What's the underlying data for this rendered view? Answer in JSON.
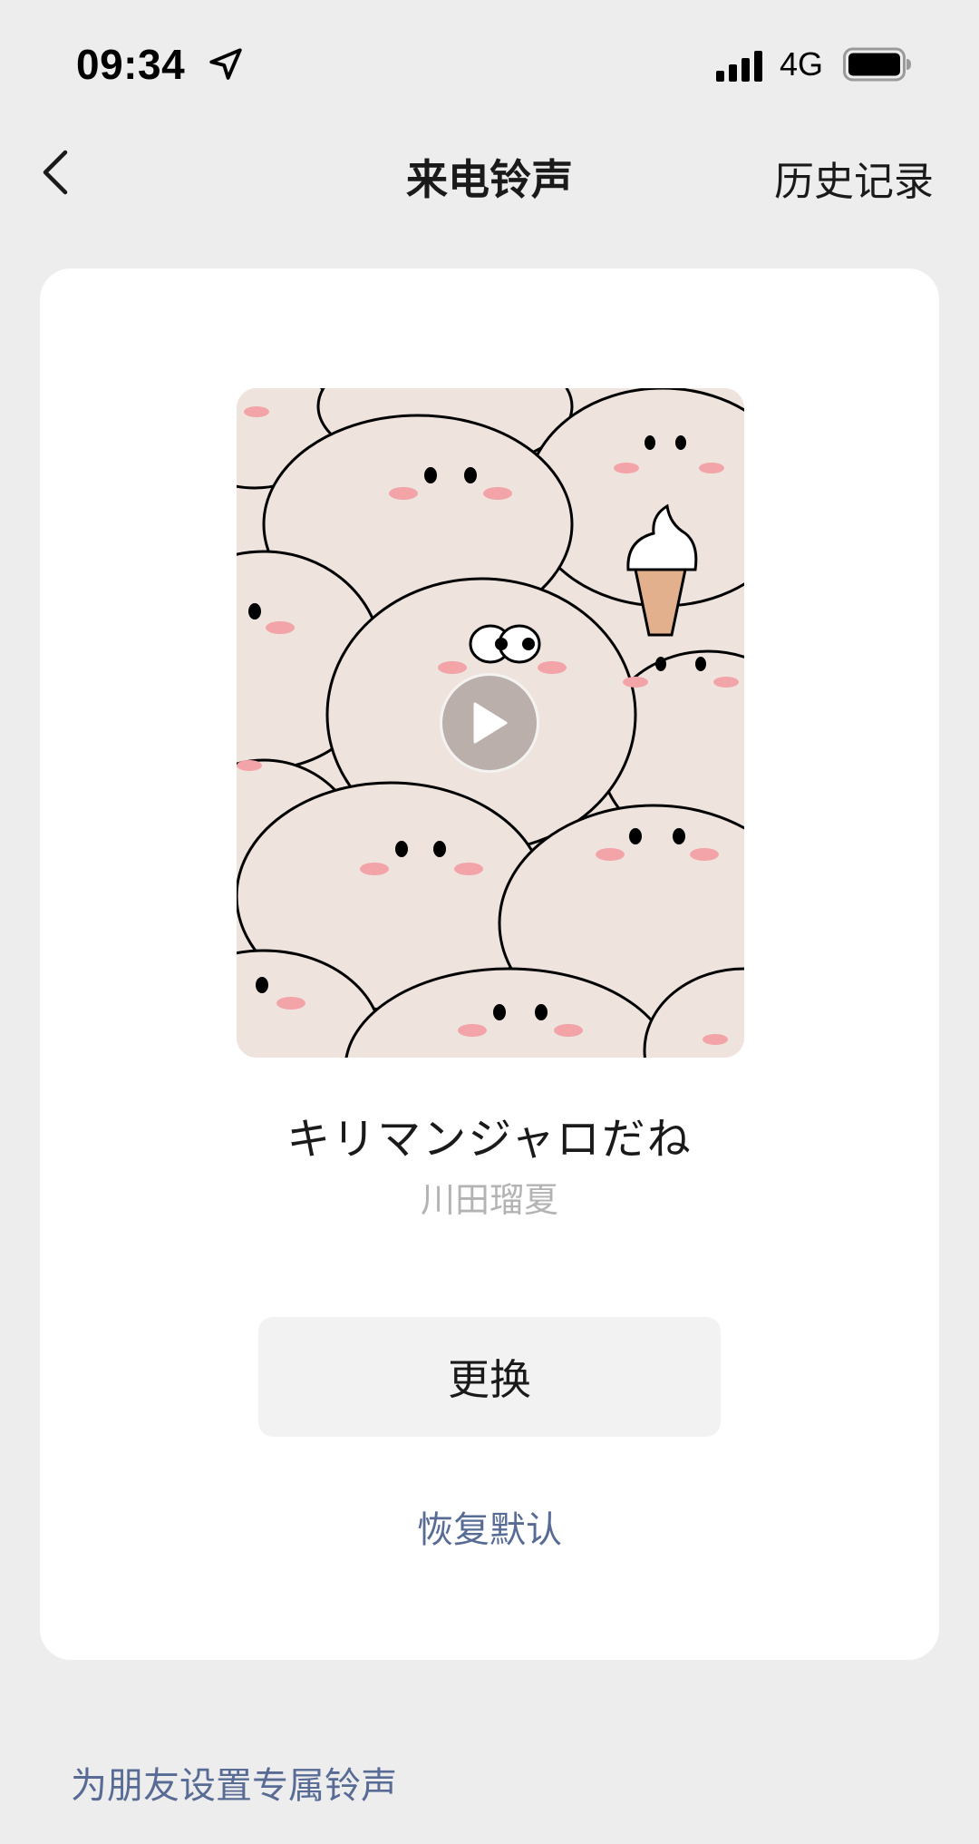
{
  "status_bar": {
    "time": "09:34",
    "network": "4G",
    "icons": [
      "location-arrow-icon",
      "signal-bars-icon",
      "battery-icon"
    ]
  },
  "nav": {
    "title": "来电铃声",
    "history": "历史记录",
    "back_icon": "chevron-left-icon"
  },
  "ringtone": {
    "title": "キリマンジャロだね",
    "artist": "川田瑠夏",
    "cover_icon": "play-icon"
  },
  "actions": {
    "change": "更换",
    "restore": "恢复默认"
  },
  "footer": {
    "friend_ringtone": "为朋友设置专属铃声"
  },
  "colors": {
    "background": "#ededed",
    "card": "#ffffff",
    "link": "#576b95",
    "cover_bg": "#efe3dd",
    "blush": "#f2a4a8"
  }
}
